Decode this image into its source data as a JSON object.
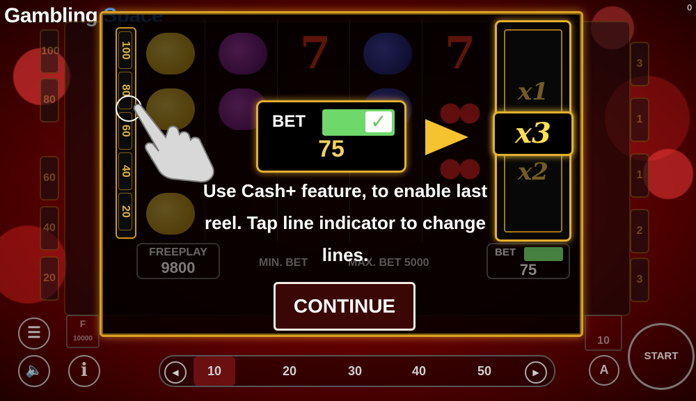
{
  "branding": {
    "logo_part1": "Gambling",
    "logo_part2": "Space",
    "corner": "0"
  },
  "line_indicator": [
    "100",
    "80",
    "60",
    "40",
    "20"
  ],
  "left_side_indicator": [
    "100",
    "80",
    "60",
    "40",
    "20"
  ],
  "right_side_indicator": [
    "3",
    "1",
    "1",
    "2",
    "3"
  ],
  "dialog": {
    "bet_label": "BET",
    "bet_value": "75",
    "check_icon": "✓",
    "multipliers": {
      "top": "x1",
      "selected": "x3",
      "bottom": "x2"
    },
    "message": "Use Cash+ feature, to enable last reel. Tap line indicator to change lines.",
    "continue_label": "CONTINUE"
  },
  "background_game": {
    "freeplay_label": "FREEPLAY",
    "freeplay_value": "9800",
    "min_bet": "MIN. BET",
    "max_bet": "MAX. BET 5000",
    "bet_label": "BET",
    "bet_value": "75",
    "left_panel_label": "F",
    "left_panel_value": "10000",
    "right_panel_value": "10"
  },
  "bottom_bar": {
    "lines": [
      "10",
      "20",
      "30",
      "40",
      "50"
    ],
    "active_line": "10",
    "start_label": "START",
    "auto_label": "A",
    "info_label": "i"
  },
  "colors": {
    "accent_gold": "#e2b030",
    "toggle_green": "#6fd86a",
    "continue_bg": "#3a0606",
    "logo_blue": "#2e86ff"
  }
}
